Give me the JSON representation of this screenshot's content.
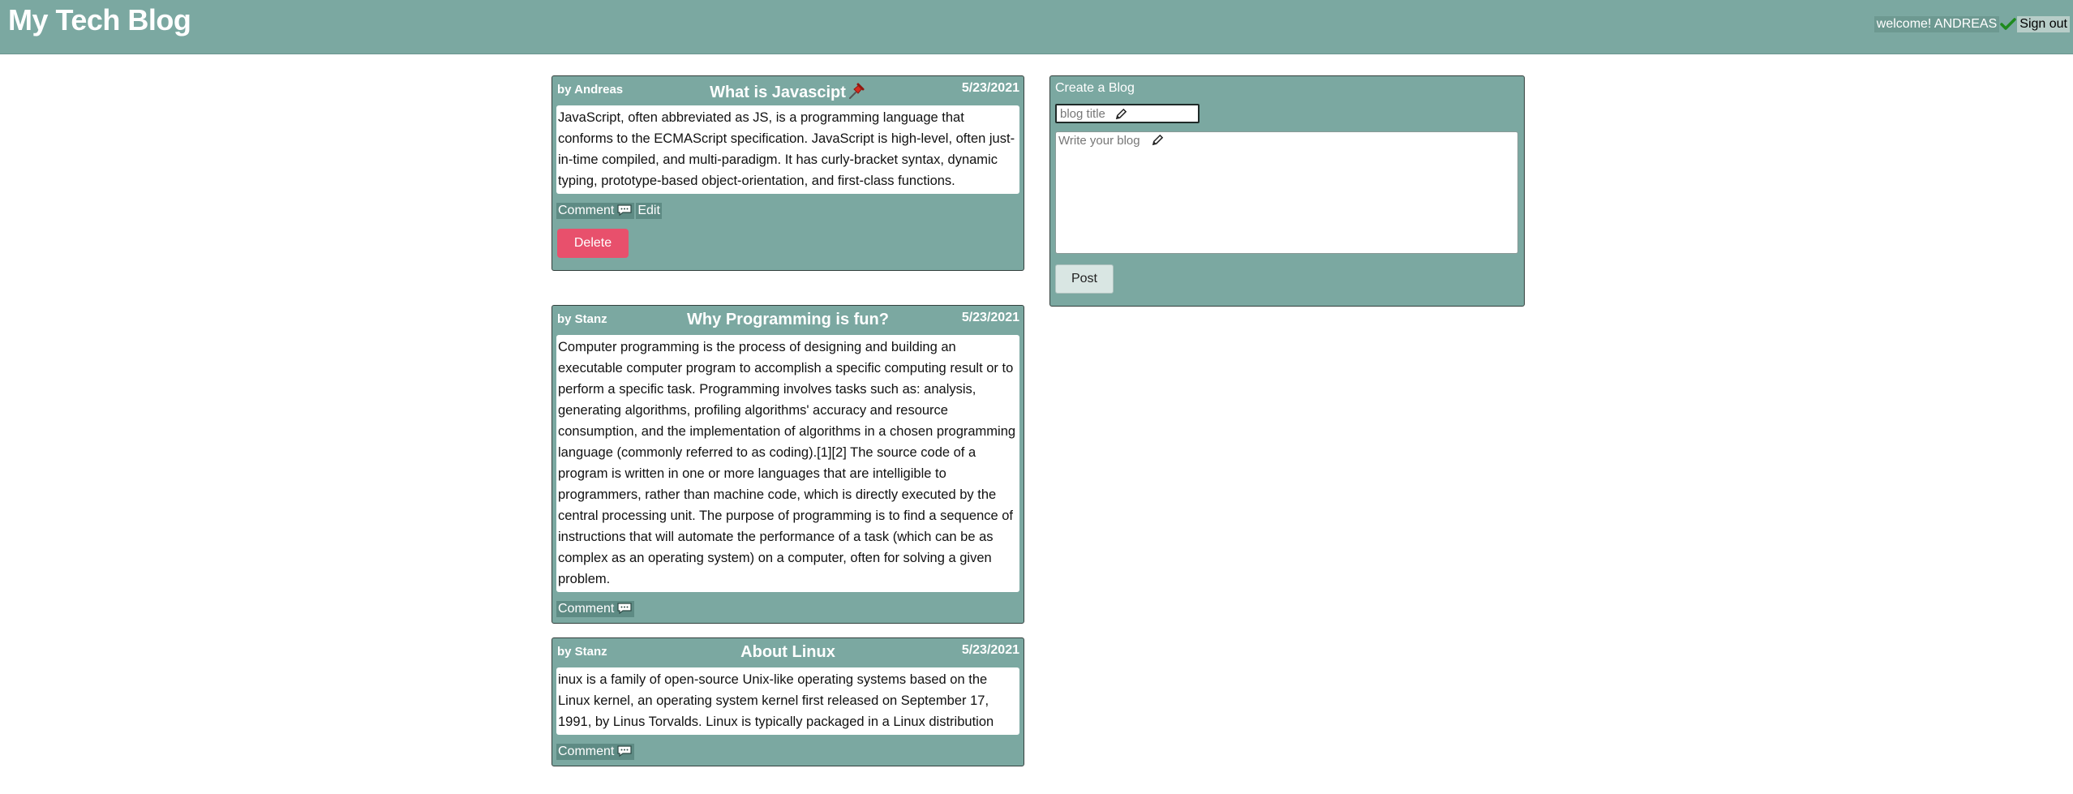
{
  "header": {
    "title": "My Tech Blog",
    "welcome": "welcome! ANDREAS",
    "signout_label": "Sign out"
  },
  "posts": [
    {
      "author": "by Andreas",
      "title": "What is Javascipt",
      "date": "5/23/2021",
      "pinned": true,
      "body": "JavaScript, often abbreviated as JS, is a programming language that conforms to the ECMAScript specification. JavaScript is high-level, often just-in-time compiled, and multi-paradigm. It has curly-bracket syntax, dynamic typing, prototype-based object-orientation, and first-class functions.",
      "comment_label": "Comment",
      "edit_label": "Edit",
      "delete_label": "Delete"
    },
    {
      "author": "by Stanz",
      "title": "Why Programming is fun?",
      "date": "5/23/2021",
      "body": "Computer programming is the process of designing and building an executable computer program to accomplish a specific computing result or to perform a specific task. Programming involves tasks such as: analysis, generating algorithms, profiling algorithms' accuracy and resource consumption, and the implementation of algorithms in a chosen programming language (commonly referred to as coding).[1][2] The source code of a program is written in one or more languages that are intelligible to programmers, rather than machine code, which is directly executed by the central processing unit. The purpose of programming is to find a sequence of instructions that will automate the performance of a task (which can be as complex as an operating system) on a computer, often for solving a given problem.",
      "comment_label": "Comment"
    },
    {
      "author": "by Stanz",
      "title": "About Linux",
      "date": "5/23/2021",
      "body": "inux is a family of open-source Unix-like operating systems based on the Linux kernel, an operating system kernel first released on September 17, 1991, by Linus Torvalds. Linux is typically packaged in a Linux distribution",
      "comment_label": "Comment"
    }
  ],
  "create": {
    "heading": "Create a Blog",
    "title_placeholder": "blog title",
    "body_placeholder": "Write your blog",
    "post_label": "Post"
  },
  "colors": {
    "header_bg": "#7ba8a1",
    "card_bg": "#7ba8a1",
    "delete": "#e8506c"
  },
  "icons": {
    "pin": "pushpin-icon",
    "check": "checkmark-icon",
    "comment": "speech-bubble-icon",
    "pencil": "pencil-icon"
  }
}
